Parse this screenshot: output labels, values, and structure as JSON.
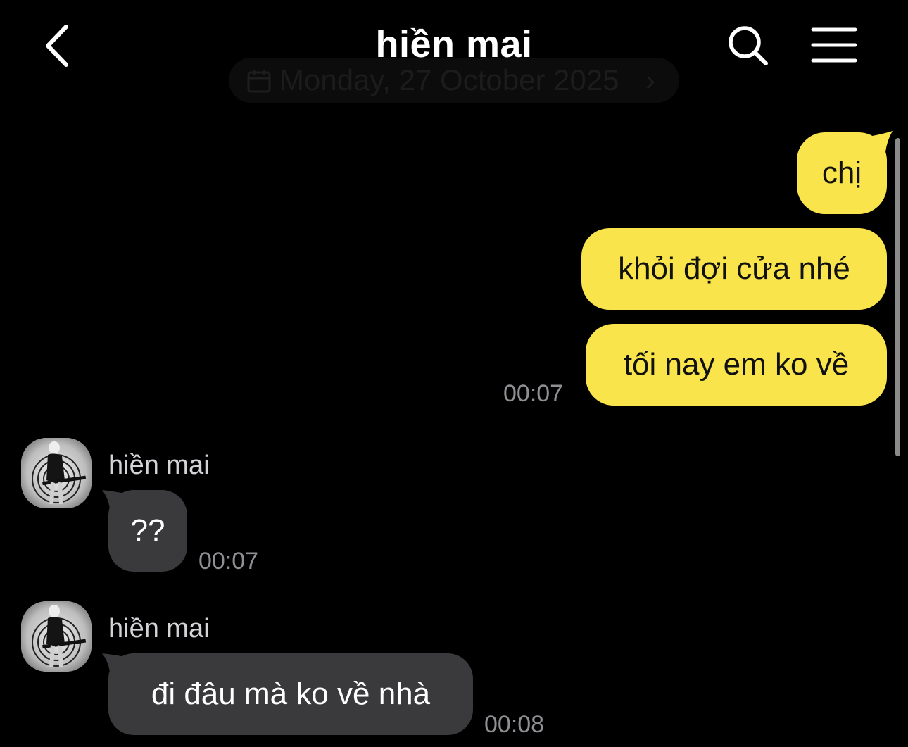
{
  "header": {
    "title": "hiền mai",
    "back_icon": "chevron-left-icon",
    "search_icon": "search-icon",
    "menu_icon": "hamburger-menu-icon"
  },
  "date_divider": {
    "text": "Monday, 27 October 2025",
    "chevron": "›",
    "icon": "calendar-icon"
  },
  "messages": [
    {
      "direction": "outgoing",
      "text": "chị"
    },
    {
      "direction": "outgoing",
      "text": "khỏi đợi cửa nhé"
    },
    {
      "direction": "outgoing",
      "text": "tối nay em ko về",
      "time": "00:07"
    },
    {
      "direction": "incoming",
      "sender": "hiền mai",
      "text": "??",
      "time": "00:07"
    },
    {
      "direction": "incoming",
      "sender": "hiền mai",
      "text": "đi đâu mà ko về nhà",
      "time": "00:08"
    }
  ],
  "colors": {
    "background": "#000000",
    "outgoing_bubble": "#fae44b",
    "incoming_bubble": "#3a3a3c",
    "timestamp": "#8e8e93"
  }
}
